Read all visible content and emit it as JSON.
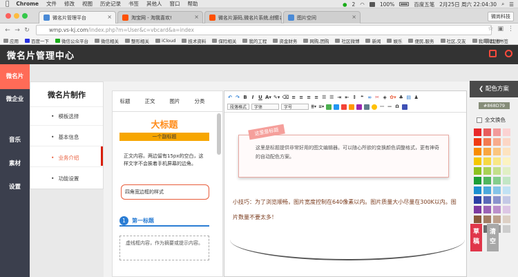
{
  "menubar": {
    "apple": "",
    "items": [
      "Chrome",
      "文件",
      "修改",
      "视图",
      "历史记录",
      "书签",
      "其他人",
      "窗口",
      "帮助"
    ],
    "wechat_badge": "2",
    "battery": "100%",
    "input": "百度五笔",
    "datetime": "2月25日 周六 22:04:30"
  },
  "tabs": [
    {
      "title": "微名片管理平台",
      "active": true,
      "color": "#4a8ad6"
    },
    {
      "title": "淘宝网 - 淘我喜欢!",
      "active": false,
      "color": "#ff5000"
    },
    {
      "title": "微名片源码,微名片系统,创意名",
      "active": false,
      "color": "#ff5000"
    },
    {
      "title": "图片空间",
      "active": false,
      "color": "#4a8ad6"
    }
  ],
  "profile": "微尚科技",
  "url": {
    "host": "wmp.vs-kj.com",
    "path": "/index.php?m=User&c=vbcard&a=index"
  },
  "bookmarks": [
    "应用",
    "百度一下",
    "微信公众平台",
    "微信相关",
    "整形相关",
    "iCloud",
    "技术资料",
    "保险相关",
    "我的工程",
    "资金财务",
    "网购,团购",
    "社区微博",
    "新闻",
    "娱乐",
    "便民,服务",
    "社区,交友",
    "我的微工作"
  ],
  "bookmarks_more": "其他书签",
  "app": {
    "title": "微名片管理中心"
  },
  "sidebar": [
    "微名片",
    "微企业",
    "音乐",
    "素材",
    "设置"
  ],
  "subnav": {
    "title": "微名片制作",
    "items": [
      "模板选择",
      "基本信息",
      "业务介绍",
      "功能设置"
    ]
  },
  "template_panel": {
    "tabs": [
      "标题",
      "正文",
      "图片",
      "分类"
    ],
    "big_title": "大标题",
    "big_subtitle": "一个副标题",
    "body_text": "正文内容。两边留有15px的空白，这样文字不会挨着手机屏幕的边角。",
    "round_box": "四角宽边框的样式",
    "numbered_no": "1",
    "numbered_title": "第一标题",
    "dashed_text": "虚线框内容，作为摘要或提示内容。"
  },
  "editor": {
    "format_select": "段落格式",
    "font_select": "字体",
    "size_select": "字号",
    "card_title": "这里是标题",
    "card_body": "这里是标题提供非常好用的图文编辑器。可以随心所欲的变换颜色调整格式，更有神奇的自动配色方案。",
    "tip": "小技巧：为了浏览顺畅，图片宽度控制在640像素以内。图片质量大小尽量在300K以内。图片数量不要太多！"
  },
  "color_panel": {
    "title": "配色方案",
    "hex": "#868D79",
    "all_label": "全文换色",
    "draft_button": "草稿",
    "clear_button": "清空",
    "swatches": [
      "#e8292a",
      "#e85c5c",
      "#f29a9a",
      "#fbd2d2",
      "#ef3a12",
      "#f37a4f",
      "#f8ab8c",
      "#fcd6c5",
      "#f88c00",
      "#f9a63f",
      "#fbc57e",
      "#fde3bf",
      "#f5c700",
      "#f6d842",
      "#f9e784",
      "#fcf3c1",
      "#8dc21f",
      "#a8d154",
      "#c3df8a",
      "#e1efc5",
      "#1b9e36",
      "#4fb65e",
      "#84cd8c",
      "#c2e6c5",
      "#1a8fd0",
      "#4aa8dc",
      "#84c4e8",
      "#c1e2f4",
      "#2b3fa4",
      "#5a68b8",
      "#8a93cd",
      "#c4c9e6",
      "#7d3aa0",
      "#9b62b5",
      "#bb8fcb",
      "#ddc7e5",
      "#8a5a3a",
      "#a27c62",
      "#bda08c",
      "#ddd0c5",
      "#3a3a3a",
      "#6b6b6b",
      "#9c9c9c",
      "#cdcdcd"
    ]
  }
}
